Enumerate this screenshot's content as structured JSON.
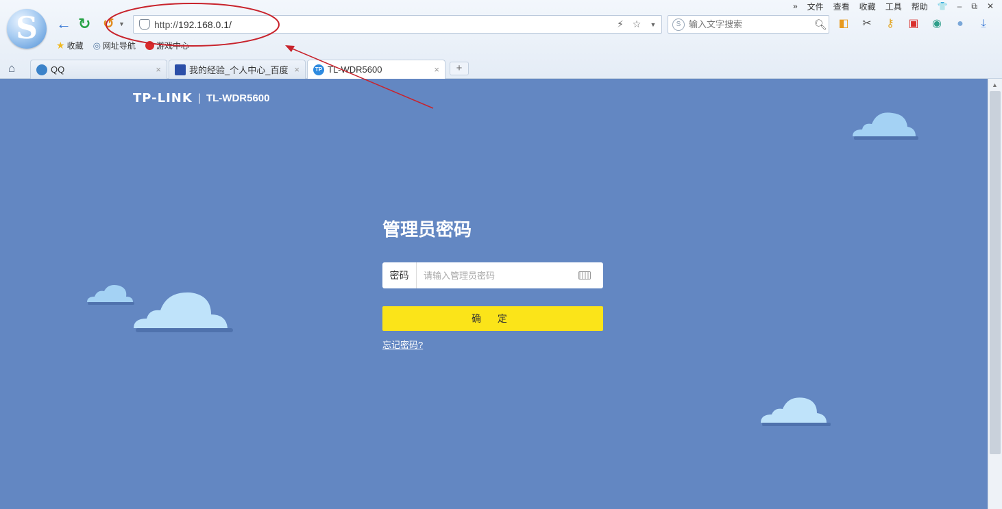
{
  "browser": {
    "logo_letter": "S",
    "menu": [
      "»",
      "文件",
      "查看",
      "收藏",
      "工具",
      "帮助"
    ],
    "address": {
      "url_proto": "http://",
      "url_host": "192.168.0.1/"
    },
    "search": {
      "placeholder": "输入文字搜索",
      "logo_text": "S"
    },
    "favorites": [
      {
        "label": "收藏"
      },
      {
        "label": "网址导航"
      },
      {
        "label": "游戏中心"
      }
    ],
    "tabs": [
      {
        "label": "QQ",
        "icon_text": "",
        "active": false
      },
      {
        "label": "我的经验_个人中心_百度",
        "icon_text": "",
        "active": false
      },
      {
        "label": "TL-WDR5600",
        "icon_text": "TP",
        "active": true
      }
    ],
    "new_tab_label": "+",
    "close_glyph": "×"
  },
  "page": {
    "brand": {
      "logo": "TP-LINK",
      "separator": "|",
      "model": "TL-WDR5600"
    },
    "title": "管理员密码",
    "password": {
      "label": "密码",
      "placeholder": "请输入管理员密码"
    },
    "confirm_label": "确 定",
    "forgot_label": "忘记密码?"
  },
  "colors": {
    "page_bg": "#6387c2",
    "button_yellow": "#fbe419",
    "cloud_light": "#bfe3fa",
    "cloud_dark": "#a4d2f4",
    "annotation_red": "#c8232c"
  },
  "icons": [
    "back-arrow-icon",
    "refresh-icon",
    "undo-icon",
    "shield-icon",
    "lightning-icon",
    "star-icon",
    "search-icon",
    "keyboard-icon",
    "home-icon",
    "download-icon"
  ]
}
